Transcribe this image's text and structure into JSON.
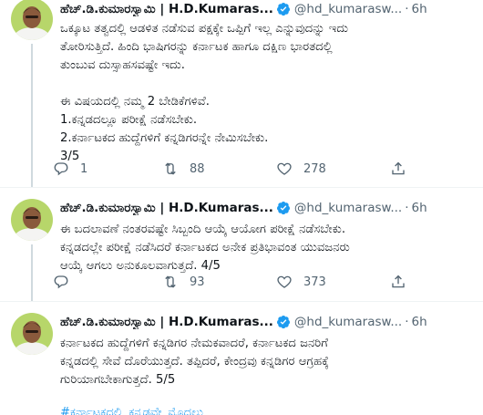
{
  "colors": {
    "link": "#1d9bf0",
    "muted": "#536471",
    "text": "#0f1419",
    "verified": "#1d9bf0"
  },
  "tweets": [
    {
      "author_name": "ಹೆಚ್.ಡಿ.ಕುಮಾರಸ್ವಾಮಿ | H.D.Kumaras...",
      "handle": "@hd_kumarasw...",
      "dot": "·",
      "time": "6h",
      "lines": [
        "ಒಕ್ಕೂಟ ತತ್ವದಲ್ಲಿ ಆಡಳಿತ ನಡೆಸುವ ಪಕ್ಷಕ್ಕೇ ಒಪ್ಪಿಗೆ ಇಲ್ಲ ಎನ್ನುವುದನ್ನು ಇದು",
        "ತೋರಿಸುತ್ತಿದೆ. ಹಿಂದಿ ಭಾಷಿಗರನ್ನು ಕರ್ನಾಟಕ ಹಾಗೂ ದಕ್ಷಿಣ ಭಾರತದಲ್ಲಿ",
        "ತುಂಬುವ ದುಸ್ಸಾಹಸವಷ್ಟೇ ಇದು.",
        "",
        "ಈ ವಿಷಯದಲ್ಲಿ ನಮ್ಮ 2 ಬೇಡಿಕೆಗಳಿವೆ.",
        "1.ಕನ್ನಡದಲ್ಲೂ ಪರೀಕ್ಷೆ ನಡೆಸಬೇಕು.",
        "2.ಕರ್ನಾಟಕದ ಹುದ್ದೆಗಳಿಗೆ ಕನ್ನಡಿಗರನ್ನೇ ನೇಮಿಸಬೇಕು.",
        "3/5"
      ],
      "reply_count": "1",
      "retweet_count": "88",
      "like_count": "278"
    },
    {
      "author_name": "ಹೆಚ್.ಡಿ.ಕುಮಾರಸ್ವಾಮಿ | H.D.Kumaras...",
      "handle": "@hd_kumarasw...",
      "dot": "·",
      "time": "6h",
      "lines": [
        "ಈ ಬದಲಾವಣೆ ನಂತರವಷ್ಟೇ ಸಿಬ್ಬಂದಿ ಆಯ್ಕೆ ಆಯೋಗ ಪರೀಕ್ಷೆ ನಡೆಸಬೇಕು.",
        "ಕನ್ನಡದಲ್ಲೇ ಪರೀಕ್ಷೆ ನಡೆಸಿದರೆ ಕರ್ನಾಟಕದ ಅನೇಕ ಪ್ರತಿಭಾವಂತ ಯುವಜನರು",
        "ಆಯ್ಕೆ ಆಗಲು ಅನುಕೂಲವಾಗುತ್ತದೆ. 4/5"
      ],
      "reply_count": "",
      "retweet_count": "93",
      "like_count": "373"
    },
    {
      "author_name": "ಹೆಚ್.ಡಿ.ಕುಮಾರಸ್ವಾಮಿ | H.D.Kumaras...",
      "handle": "@hd_kumarasw...",
      "dot": "·",
      "time": "6h",
      "lines": [
        "ಕರ್ನಾಟಕದ ಹುದ್ದೆಗಳಿಗೆ ಕನ್ನಡಿಗರ ನೇಮಕವಾದರೆ, ಕರ್ನಾಟಕದ ಜನರಿಗೆ",
        "ಕನ್ನಡದಲ್ಲಿ ಸೇವೆ ದೊರೆಯುತ್ತದೆ. ತಪ್ಪಿದರೆ, ಕೇಂದ್ರವು ಕನ್ನಡಿಗರ ಆಗ್ರಹಕ್ಕೆ",
        "ಗುರಿಯಾಗಬೇಕಾಗುತ್ತದೆ. 5/5"
      ],
      "hashtag": "#ಕರ್ನಾಟಕದಲ್ಲಿ_ಕನ್ನಡವೇ_ಮೊದಲು"
    }
  ]
}
